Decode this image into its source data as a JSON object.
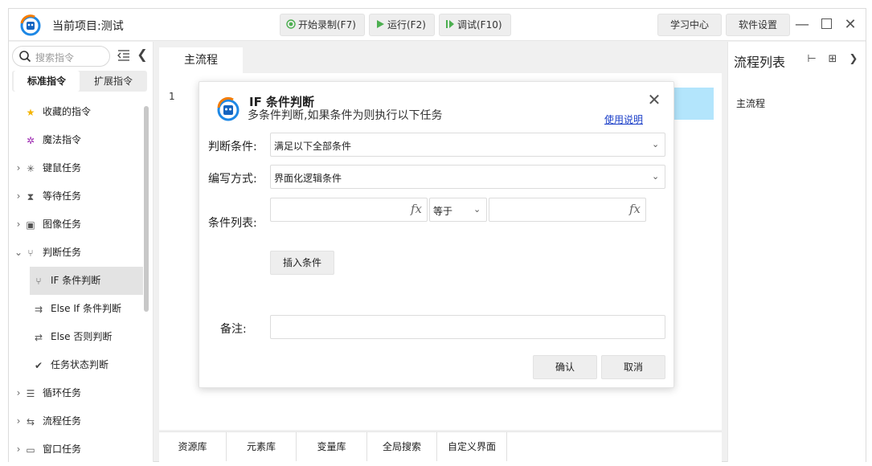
{
  "titlebar": {
    "title": "当前项目:测试",
    "record_label": "开始录制(F7)",
    "run_label": "运行(F2)",
    "debug_label": "调试(F10)",
    "learn_label": "学习中心",
    "settings_label": "软件设置"
  },
  "sidebar": {
    "search_placeholder": "搜索指令",
    "tabs": [
      "标准指令",
      "扩展指令"
    ],
    "items": [
      {
        "label": "收藏的指令",
        "icon": "star-icon"
      },
      {
        "label": "魔法指令",
        "icon": "magic-wand-icon"
      },
      {
        "label": "键鼠任务",
        "icon": "click-icon"
      },
      {
        "label": "等待任务",
        "icon": "hourglass-icon"
      },
      {
        "label": "图像任务",
        "icon": "image-icon"
      },
      {
        "label": "判断任务",
        "icon": "branch-icon"
      },
      {
        "label": "IF 条件判断",
        "icon": "branch-icon"
      },
      {
        "label": "Else If 条件判断",
        "icon": "else-if-icon"
      },
      {
        "label": "Else 否则判断",
        "icon": "else-icon"
      },
      {
        "label": "任务状态判断",
        "icon": "check-circle-icon"
      },
      {
        "label": "循环任务",
        "icon": "loop-icon"
      },
      {
        "label": "流程任务",
        "icon": "flow-icon"
      },
      {
        "label": "窗口任务",
        "icon": "window-icon"
      }
    ]
  },
  "editor": {
    "tab_label": "主流程",
    "line_number": "1"
  },
  "bottom_tabs": [
    "资源库",
    "元素库",
    "变量库",
    "全局搜索",
    "自定义界面"
  ],
  "right_panel": {
    "title": "流程列表",
    "items": [
      "主流程"
    ]
  },
  "dialog": {
    "title": "IF 条件判断",
    "subtitle": "多条件判断,如果条件为则执行以下任务",
    "help_link": "使用说明",
    "condition_label": "判断条件:",
    "condition_value": "满足以下全部条件",
    "mode_label": "编写方式:",
    "mode_value": "界面化逻辑条件",
    "list_label": "条件列表:",
    "operator_value": "等于",
    "fx_symbol": "fx",
    "insert_label": "插入条件",
    "remark_label": "备注:",
    "confirm_label": "确认",
    "cancel_label": "取消"
  },
  "colors": {
    "highlight_row": "#b3e5fc",
    "link": "#1a3ec8",
    "record_icon": "#4caf50",
    "run_icon": "#4caf50"
  }
}
